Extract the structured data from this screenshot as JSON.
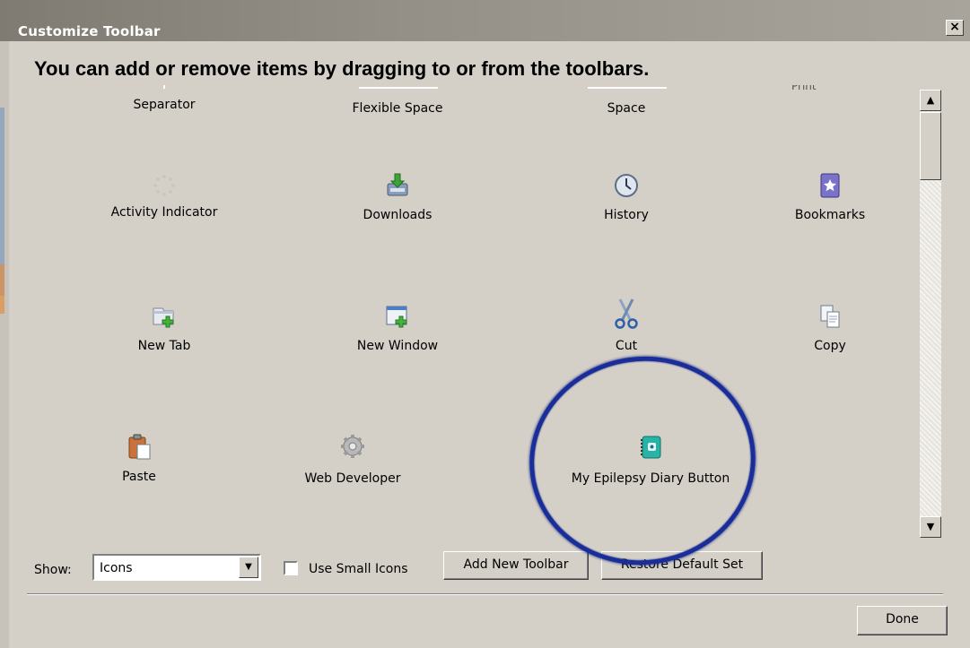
{
  "window": {
    "title": "Customize Toolbar",
    "close_glyph": "×"
  },
  "instructions": "You can add or remove items by dragging to or from the toolbars.",
  "palette": {
    "row1": [
      {
        "label": "Separator",
        "icon": "separator-icon"
      },
      {
        "label": "Flexible Space",
        "icon": "flexible-space-icon"
      },
      {
        "label": "Space",
        "icon": "space-icon"
      }
    ],
    "print_fragment": "Print",
    "row2": [
      {
        "label": "Activity Indicator",
        "icon": "activity-indicator-icon"
      },
      {
        "label": "Downloads",
        "icon": "downloads-icon"
      },
      {
        "label": "History",
        "icon": "history-clock-icon"
      },
      {
        "label": "Bookmarks",
        "icon": "bookmarks-star-icon"
      }
    ],
    "row3": [
      {
        "label": "New Tab",
        "icon": "new-tab-icon"
      },
      {
        "label": "New Window",
        "icon": "new-window-icon"
      },
      {
        "label": "Cut",
        "icon": "scissors-icon"
      },
      {
        "label": "Copy",
        "icon": "copy-icon"
      }
    ],
    "row4": [
      {
        "label": "Paste",
        "icon": "clipboard-icon"
      },
      {
        "label": "Web Developer",
        "icon": "gear-icon"
      },
      {
        "label": "My Epilepsy Diary Button",
        "icon": "diary-notebook-icon"
      }
    ]
  },
  "controls": {
    "show_label": "Show:",
    "show_value": "Icons",
    "small_icons_label": "Use Small Icons",
    "small_icons_checked": false,
    "add_toolbar": "Add New Toolbar",
    "restore_default": "Restore Default Set",
    "done": "Done"
  },
  "colors": {
    "annotation_circle": "#1a2e9a",
    "dialog_bg": "#d4d0c8"
  }
}
